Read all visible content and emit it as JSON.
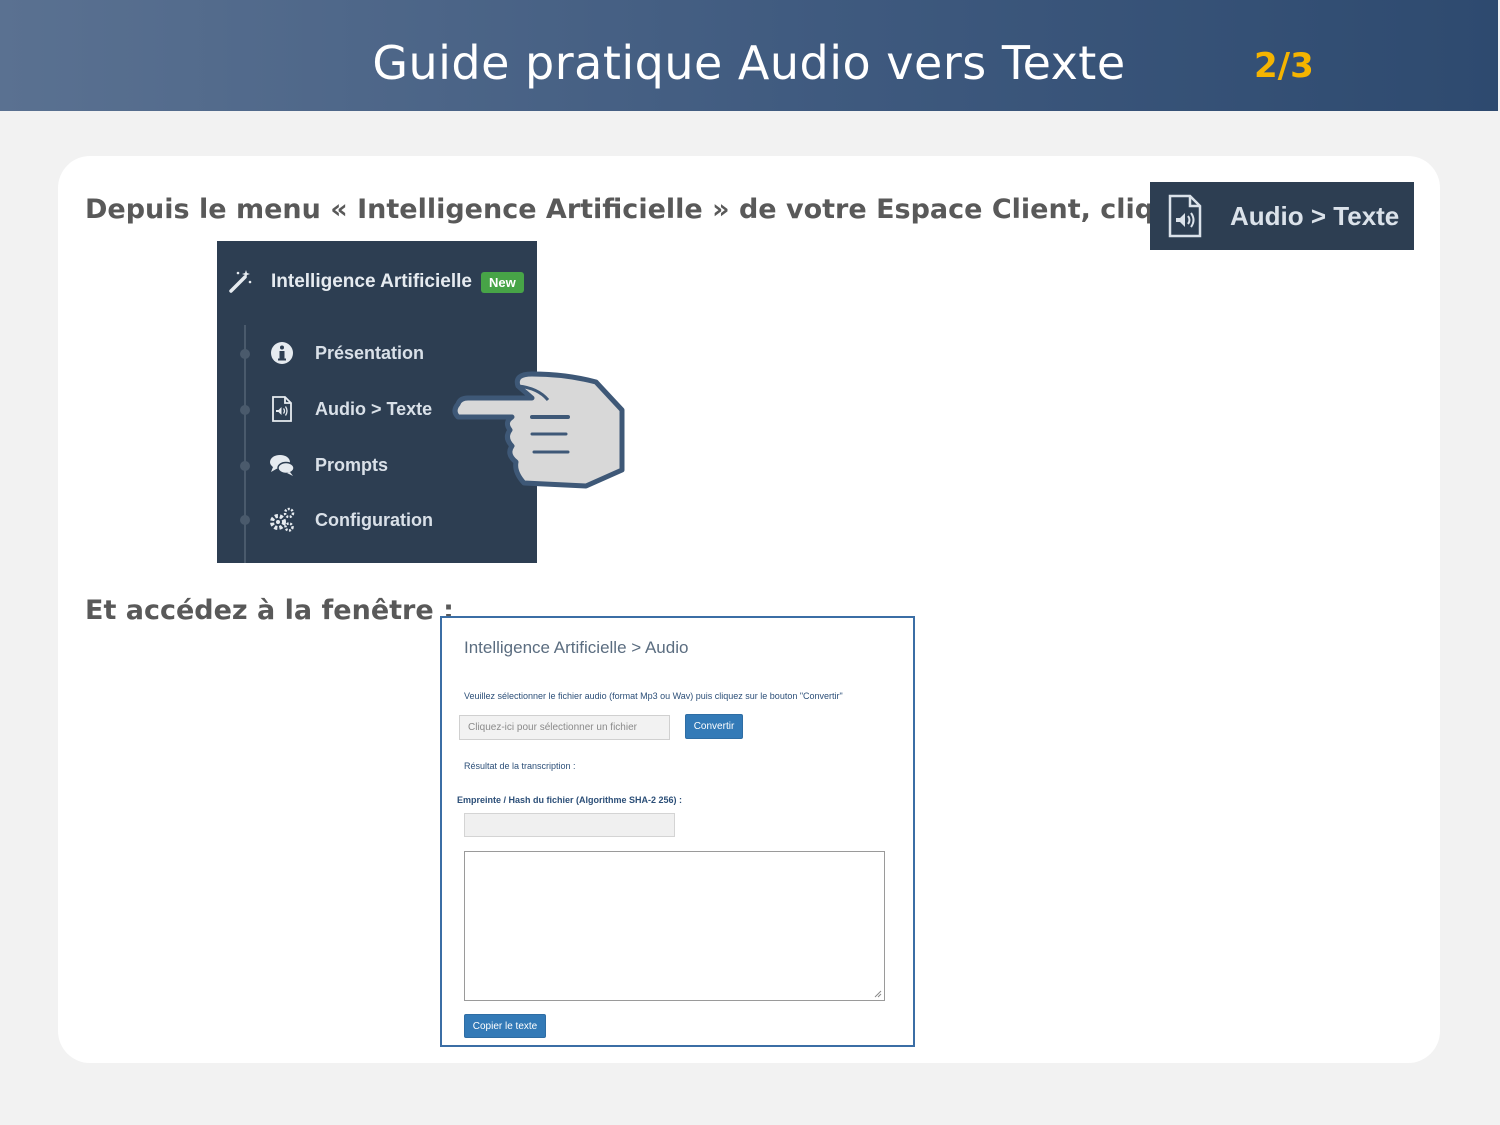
{
  "header": {
    "title": "Guide pratique Audio vers Texte",
    "page_indicator": "2/3"
  },
  "step1": {
    "text": "Depuis le menu « Intelligence Artificielle » de votre Espace Client, cliquez sur",
    "button_label": "Audio > Texte",
    "button_icon": "audio-file-icon"
  },
  "menu": {
    "title": "Intelligence Artificielle",
    "badge": "New",
    "title_icon": "magic-wand-icon",
    "items": [
      {
        "label": "Présentation",
        "icon": "info-icon"
      },
      {
        "label": "Audio > Texte",
        "icon": "audio-file-icon"
      },
      {
        "label": "Prompts",
        "icon": "chat-bubbles-icon"
      },
      {
        "label": "Configuration",
        "icon": "gears-icon"
      }
    ]
  },
  "step2": {
    "text": "Et accédez à la fenêtre :"
  },
  "window": {
    "title": "Intelligence Artificielle > Audio",
    "instruction": "Veuillez sélectionner le fichier audio (format Mp3 ou Wav) puis cliquez sur le bouton \"Convertir\"",
    "file_placeholder": "Cliquez-ici pour sélectionner un fichier",
    "convert_button": "Convertir",
    "result_label": "Résultat de la transcription :",
    "hash_label": "Empreinte / Hash du fichier (Algorithme SHA-2 256) :",
    "hash_value": "",
    "text_value": "",
    "copy_button": "Copier le texte"
  },
  "colors": {
    "header_bg": "#3f5a7f",
    "page_indicator": "#f5b400",
    "menu_bg": "#2d3e52",
    "badge_green": "#47a447",
    "button_blue": "#337ab7"
  }
}
